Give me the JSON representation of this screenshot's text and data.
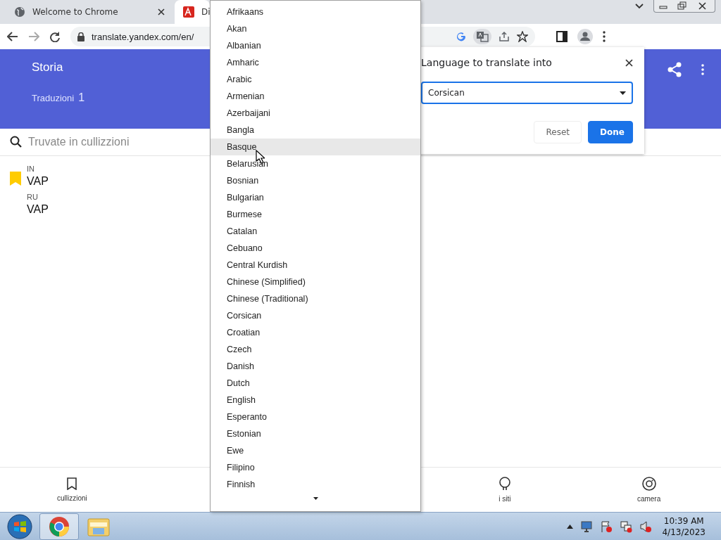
{
  "browser": {
    "tabs": [
      {
        "title": "Welcome to Chrome",
        "selected": false
      },
      {
        "title": "Di",
        "selected": true
      }
    ],
    "address": "translate.yandex.com/en/"
  },
  "header": {
    "title": "Storia",
    "subtitle": "Traduzioni",
    "count": "1"
  },
  "search": {
    "placeholder": "Truvate in cullizzioni"
  },
  "history": [
    {
      "source_lang": "IN",
      "source_text": "VAP",
      "target_lang": "RU",
      "target_text": "VAP",
      "bookmarked": true
    }
  ],
  "bottom_nav": [
    {
      "label": "cullizzioni",
      "kind": "bookmark"
    },
    {
      "label": "i siti",
      "kind": "bulb"
    },
    {
      "label": "camera",
      "kind": "camera"
    }
  ],
  "translate_dialog": {
    "title": "Language to translate into",
    "language": "Corsican",
    "buttons": [
      "Reset",
      "Done"
    ]
  },
  "language_dropdown": {
    "options": [
      {
        "label": "Afrikaans",
        "highlighted": false
      },
      {
        "label": "Akan",
        "highlighted": false
      },
      {
        "label": "Albanian",
        "highlighted": false
      },
      {
        "label": "Amharic",
        "highlighted": false
      },
      {
        "label": "Arabic",
        "highlighted": false
      },
      {
        "label": "Armenian",
        "highlighted": false
      },
      {
        "label": "Azerbaijani",
        "highlighted": false
      },
      {
        "label": "Bangla",
        "highlighted": false
      },
      {
        "label": "Basque",
        "highlighted": true
      },
      {
        "label": "Belarusian",
        "highlighted": false
      },
      {
        "label": "Bosnian",
        "highlighted": false
      },
      {
        "label": "Bulgarian",
        "highlighted": false
      },
      {
        "label": "Burmese",
        "highlighted": false
      },
      {
        "label": "Catalan",
        "highlighted": false
      },
      {
        "label": "Cebuano",
        "highlighted": false
      },
      {
        "label": "Central Kurdish",
        "highlighted": false
      },
      {
        "label": "Chinese (Simplified)",
        "highlighted": false
      },
      {
        "label": "Chinese (Traditional)",
        "highlighted": false
      },
      {
        "label": "Corsican",
        "highlighted": false
      },
      {
        "label": "Croatian",
        "highlighted": false
      },
      {
        "label": "Czech",
        "highlighted": false
      },
      {
        "label": "Danish",
        "highlighted": false
      },
      {
        "label": "Dutch",
        "highlighted": false
      },
      {
        "label": "English",
        "highlighted": false
      },
      {
        "label": "Esperanto",
        "highlighted": false
      },
      {
        "label": "Estonian",
        "highlighted": false
      },
      {
        "label": "Ewe",
        "highlighted": false
      },
      {
        "label": "Filipino",
        "highlighted": false
      },
      {
        "label": "Finnish",
        "highlighted": false
      }
    ]
  },
  "taskbar": {
    "time": "10:39 AM",
    "date": "4/13/2023"
  }
}
